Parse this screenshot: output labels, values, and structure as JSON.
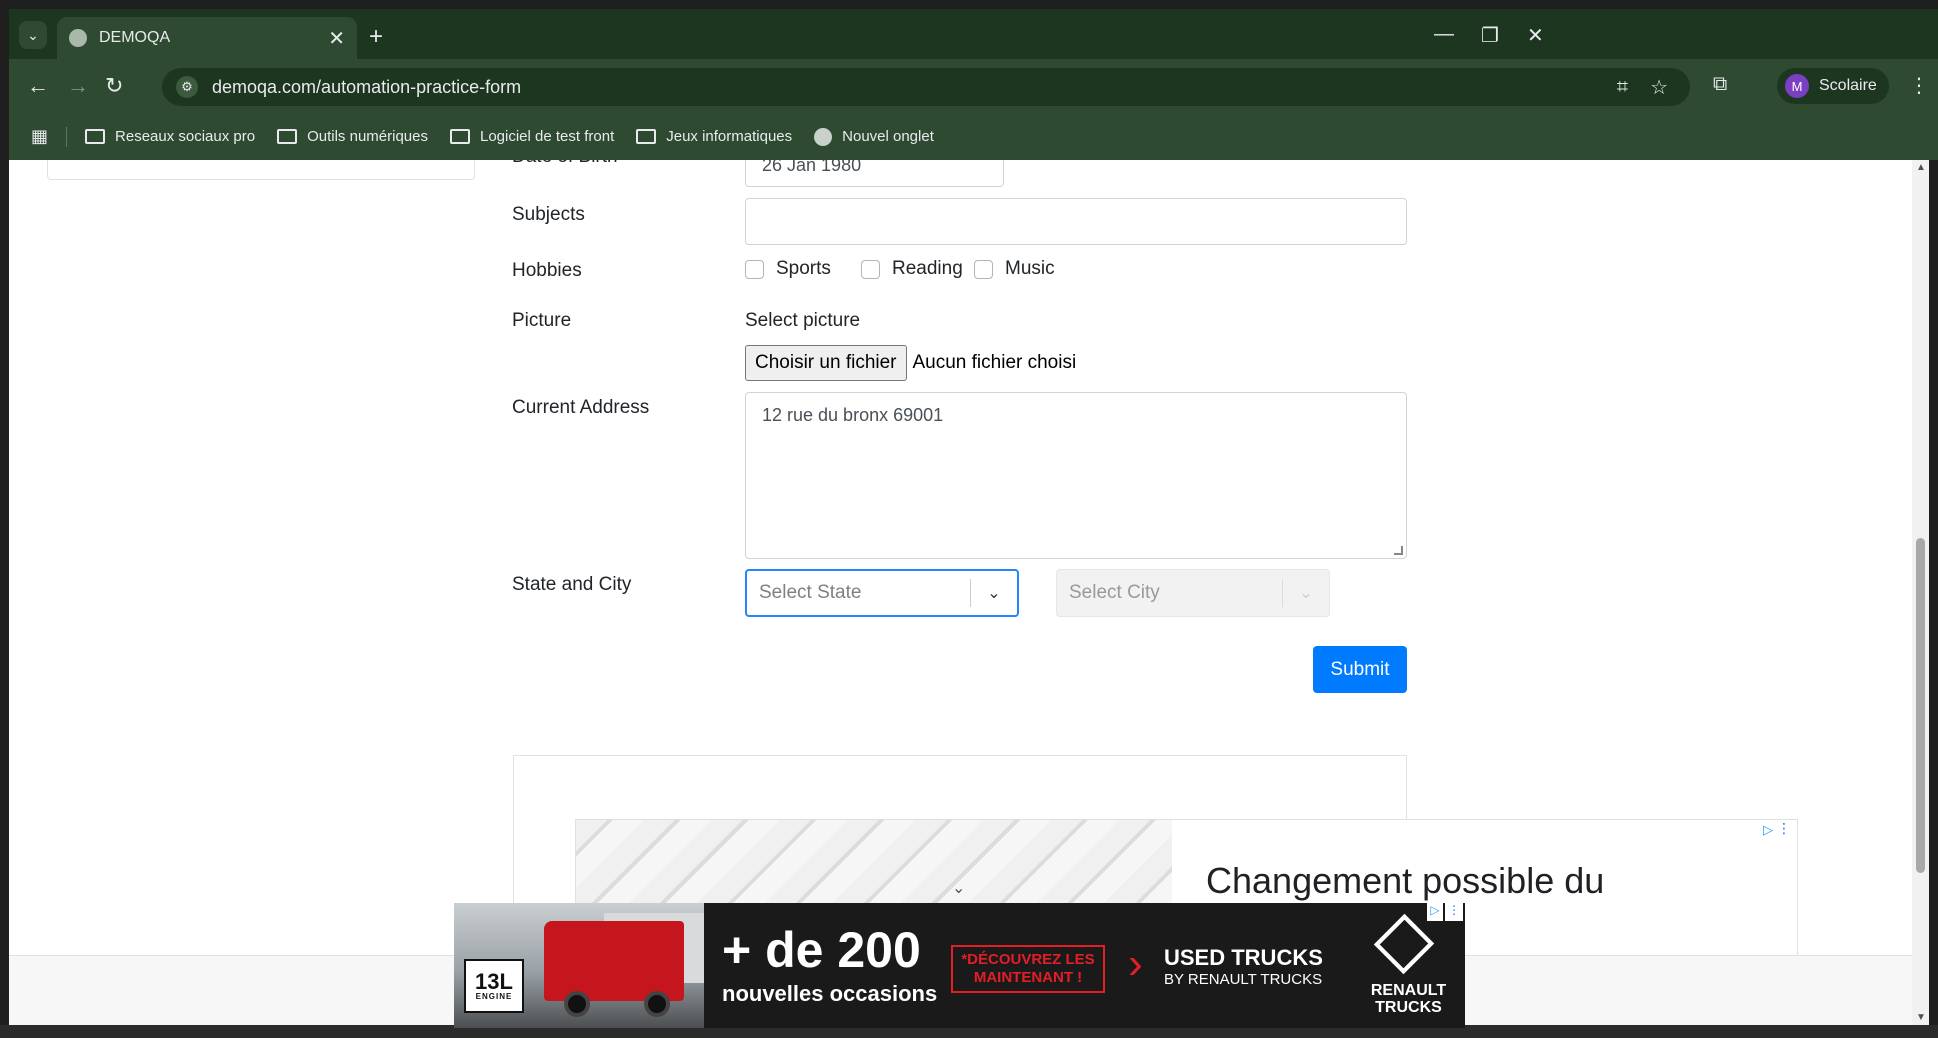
{
  "browser": {
    "tab_title": "DEMOQA",
    "tab_close": "✕",
    "new_tab": "+",
    "url": "demoqa.com/automation-practice-form",
    "profile_initial": "M",
    "profile_name": "Scolaire",
    "window": {
      "minimize": "—",
      "restore": "❐",
      "close": "✕"
    }
  },
  "bookmarks": [
    {
      "label": "Reseaux sociaux pro",
      "icon": "folder-icon"
    },
    {
      "label": "Outils numériques",
      "icon": "folder-icon"
    },
    {
      "label": "Logiciel de test front",
      "icon": "folder-icon"
    },
    {
      "label": "Jeux informatiques",
      "icon": "folder-icon"
    },
    {
      "label": "Nouvel onglet",
      "icon": "globe-icon"
    }
  ],
  "form": {
    "dob_label": "Date of Birth",
    "dob_value": "26 Jan 1980",
    "subjects_label": "Subjects",
    "subjects_value": "",
    "hobbies_label": "Hobbies",
    "hobbies": [
      "Sports",
      "Reading",
      "Music"
    ],
    "picture_label": "Picture",
    "select_picture": "Select picture",
    "file_button": "Choisir un fichier",
    "file_status": "Aucun fichier choisi",
    "address_label": "Current Address",
    "address_value": "12 rue du bronx 69001",
    "state_city_label": "State and City",
    "state_placeholder": "Select State",
    "city_placeholder": "Select City",
    "submit": "Submit"
  },
  "ads": {
    "top_headline": "Changement possible du",
    "banner_big": "+ de 200",
    "banner_sub": "nouvelles occasions",
    "banner_cta": "*DÉCOUVREZ LES MAINTENANT !",
    "banner_used": "USED TRUCKS",
    "banner_by": "BY RENAULT TRUCKS",
    "banner_brand": "RENAULT TRUCKS",
    "engine_big": "13L",
    "engine_small": "ENGINE"
  },
  "colors": {
    "browser_frame": "#1d3620",
    "submit": "#007bff",
    "select_focus": "#2684ff",
    "renault_red": "#e41e26"
  }
}
